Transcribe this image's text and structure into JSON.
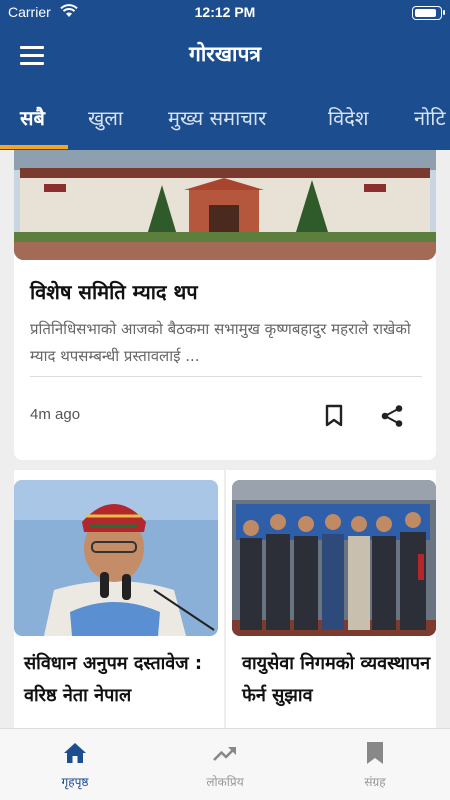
{
  "status_bar": {
    "carrier": "Carrier",
    "time": "12:12 PM",
    "battery_level": 0.9
  },
  "app_bar": {
    "title": "गोरखापत्र"
  },
  "tabs": [
    {
      "label": "सबै",
      "active": true
    },
    {
      "label": "खुला",
      "active": false
    },
    {
      "label": "मुख्य समाचार",
      "active": false
    },
    {
      "label": "विदेश",
      "active": false
    },
    {
      "label": "नोटि",
      "active": false
    }
  ],
  "featured": {
    "headline": "विशेष समिति म्याद थप",
    "summary": "प्रतिनिधिसभाको आजको बैठकमा सभामुख कृष्णबहादुर महराले राखेको म्याद थपसम्बन्धी प्रस्तावलाई ...",
    "timestamp": "4m ago"
  },
  "cards": [
    {
      "title": "संविधान अनुपम दस्तावेज : वरिष्ठ नेता नेपाल"
    },
    {
      "title": "वायुसेवा निगमको व्यवस्थापन फेर्न सुझाव"
    }
  ],
  "bottom_nav": [
    {
      "label": "गृहपृष्ठ",
      "icon": "home-icon",
      "active": true
    },
    {
      "label": "लोकप्रिय",
      "icon": "trending-icon",
      "active": false
    },
    {
      "label": "संग्रह",
      "icon": "bookmark-icon",
      "active": false
    }
  ],
  "colors": {
    "primary": "#1c4d8f",
    "accent": "#f5a623"
  }
}
